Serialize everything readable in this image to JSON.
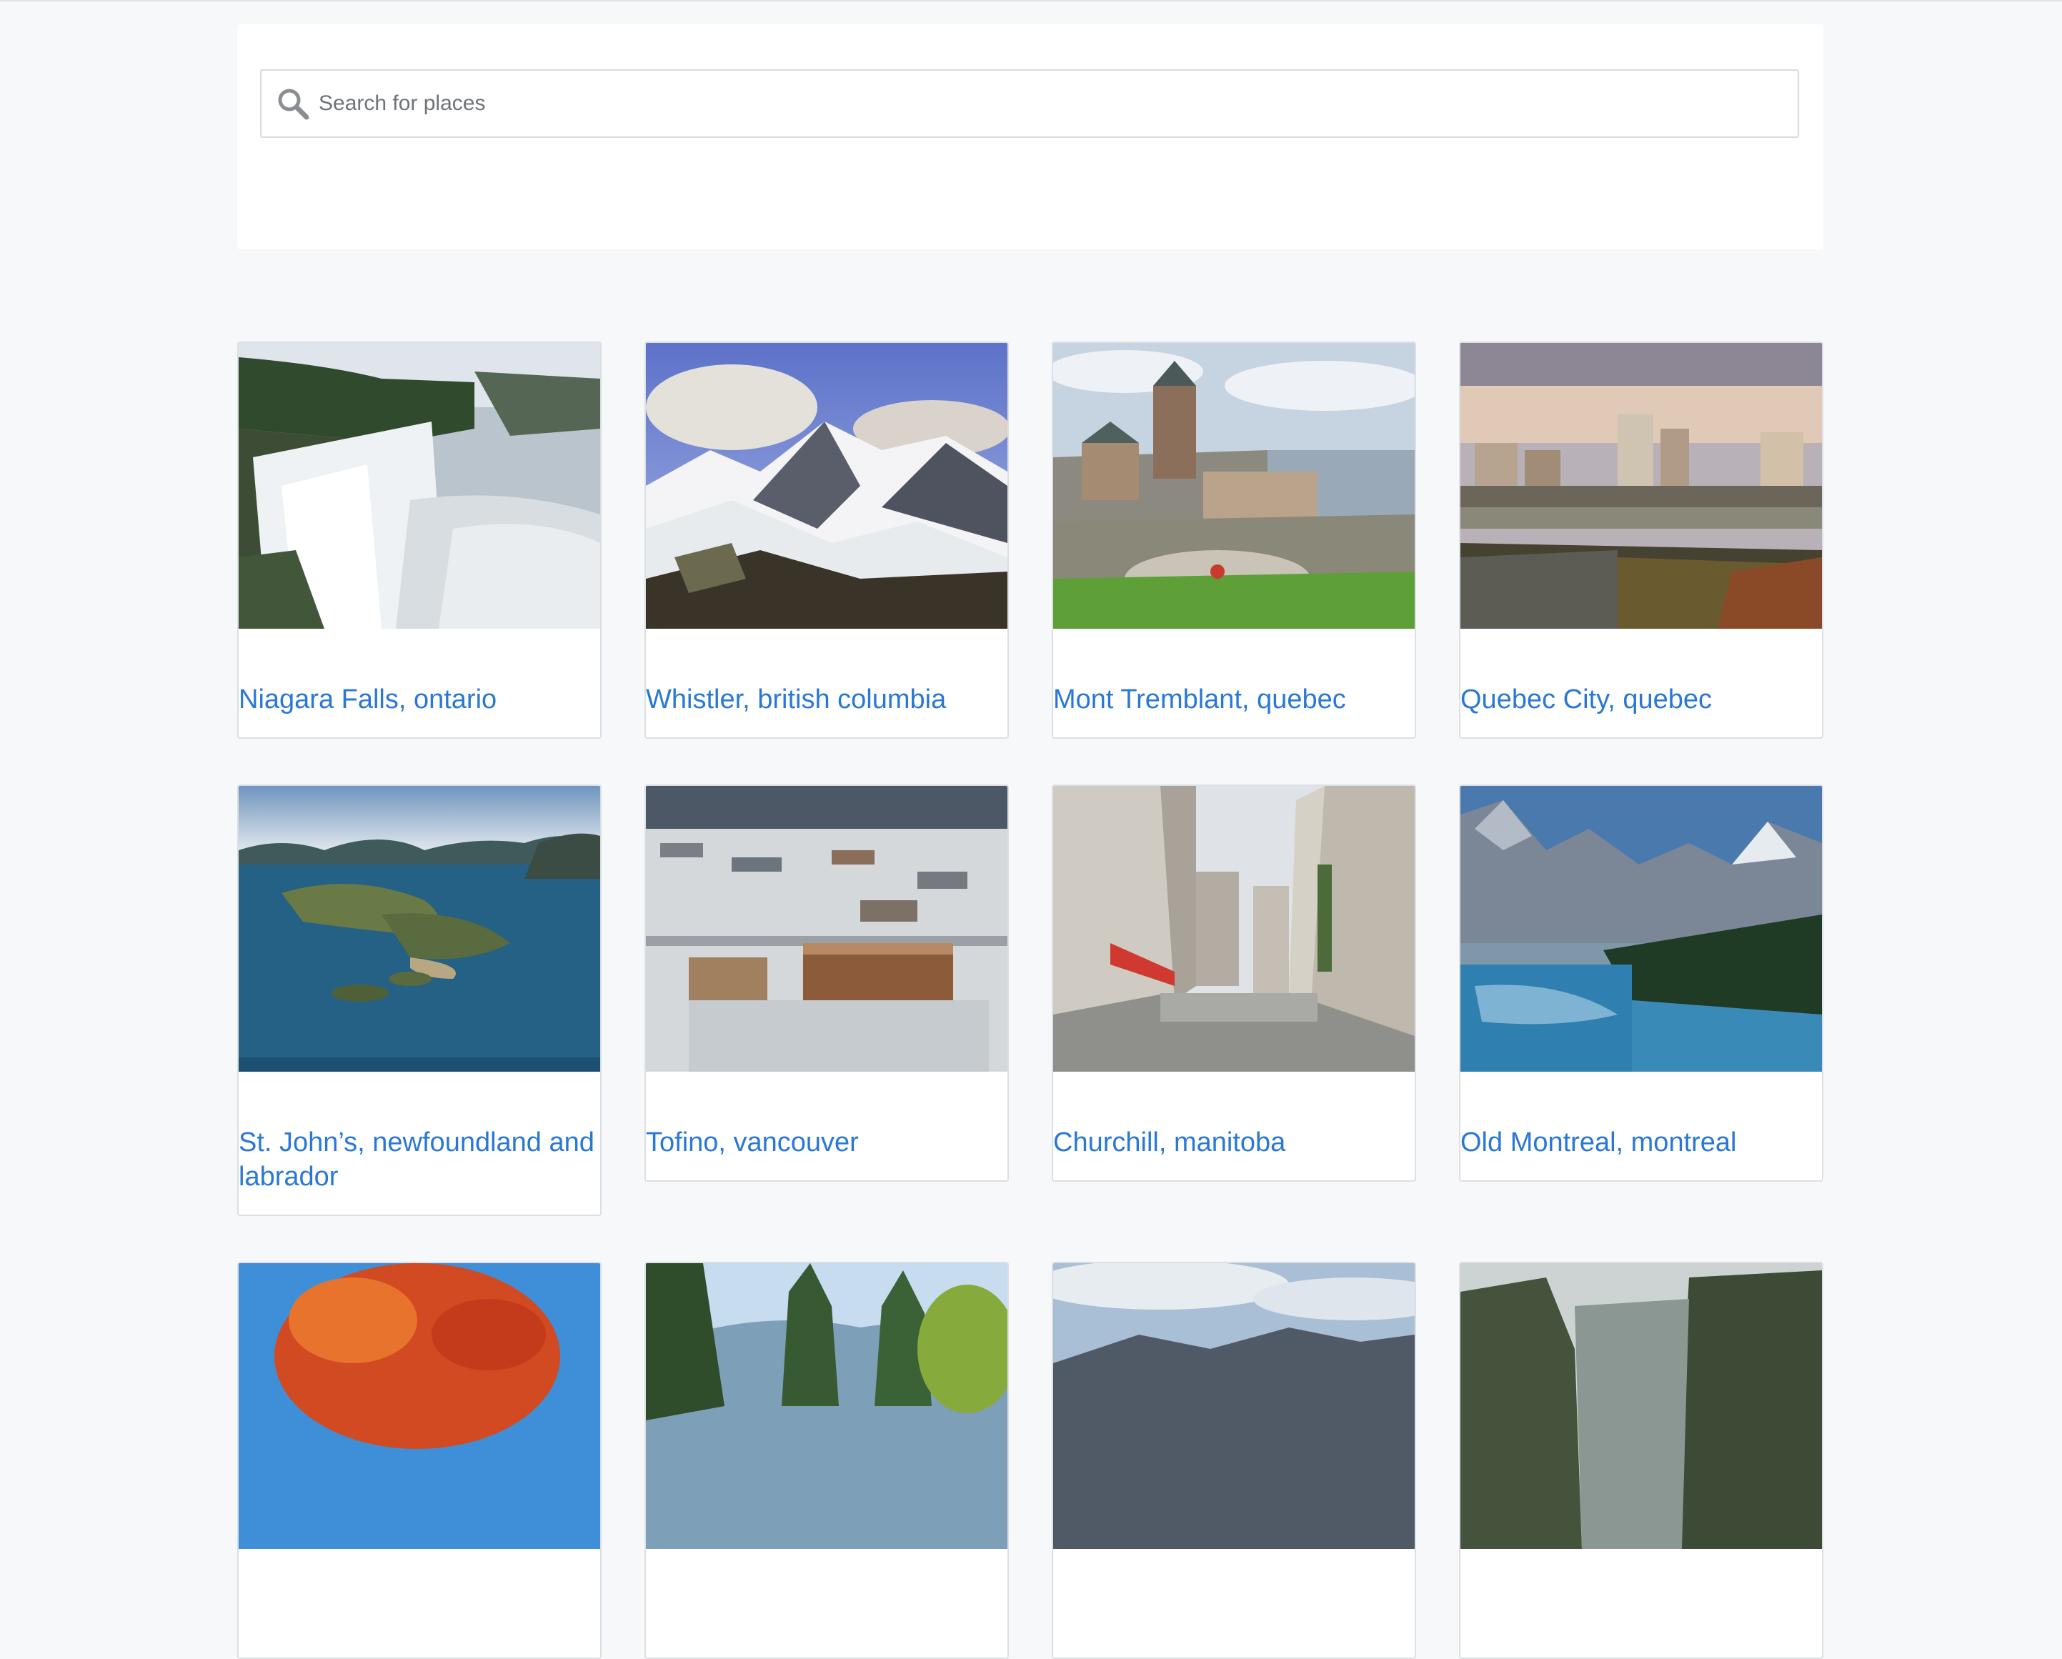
{
  "search": {
    "placeholder": "Search for places",
    "icon": "search-icon"
  },
  "colors": {
    "page_bg": "#f7f8fa",
    "link": "#2a78d6",
    "card_border": "#dcdfe3"
  },
  "places": [
    {
      "title": "Niagara Falls, ontario",
      "image": "waterfall-photo"
    },
    {
      "title": "Whistler, british columbia",
      "image": "snowy-mountains-photo"
    },
    {
      "title": "Mont Tremblant, quebec",
      "image": "chateau-city-photo"
    },
    {
      "title": "Quebec City, quebec",
      "image": "city-skyline-bridge-photo"
    },
    {
      "title": "St. John’s, newfoundland and labrador",
      "image": "islands-aerial-photo"
    },
    {
      "title": "Tofino, vancouver",
      "image": "snowy-town-aerial-photo"
    },
    {
      "title": "Churchill, manitoba",
      "image": "old-street-photo"
    },
    {
      "title": "Old Montreal, montreal",
      "image": "mountain-lake-photo"
    },
    {
      "title": "",
      "image": "autumn-tree-photo"
    },
    {
      "title": "",
      "image": "forest-hills-photo"
    },
    {
      "title": "",
      "image": "cloudy-mountains-photo"
    },
    {
      "title": "",
      "image": "fjord-cliffs-photo"
    }
  ]
}
